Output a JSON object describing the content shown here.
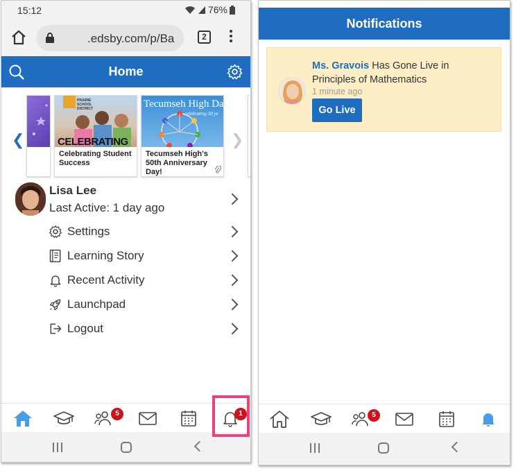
{
  "left": {
    "status": {
      "time": "15:12",
      "battery": "76%"
    },
    "browser": {
      "url": ".edsby.com/p/Ba",
      "tab_count": "2"
    },
    "header": {
      "title": "Home"
    },
    "carousel": {
      "cards": [
        {
          "caption": ""
        },
        {
          "caption": "Celebrating Student Success",
          "image_text": "CELEBRATING",
          "district": "PRAIRIE SCHOOL DISTRICT"
        },
        {
          "caption": "Tecumseh High's 50th Anniversary Day!",
          "image_text": "Tecumseh High Da",
          "image_subtext": "celebrating 50 ye"
        }
      ]
    },
    "profile": {
      "name": "Lisa Lee",
      "last_active": "Last Active: 1 day ago"
    },
    "menu": [
      {
        "label": "Settings",
        "icon": "gear-icon"
      },
      {
        "label": "Learning Story",
        "icon": "book-icon"
      },
      {
        "label": "Recent Activity",
        "icon": "bell-icon"
      },
      {
        "label": "Launchpad",
        "icon": "rocket-icon"
      },
      {
        "label": "Logout",
        "icon": "logout-icon"
      }
    ],
    "bottom_nav": {
      "groups_badge": "5",
      "notifications_badge": "1"
    }
  },
  "right": {
    "header": {
      "title": "Notifications"
    },
    "notification": {
      "sender": "Ms. Gravois",
      "message": " Has Gone Live in Principles of Mathematics",
      "time": "1 minute ago",
      "action": "Go Live"
    },
    "bottom_nav": {
      "groups_badge": "5"
    }
  },
  "colors": {
    "brand": "#1f6dc1",
    "badge": "#d0121b",
    "highlight": "#e8437e",
    "notification_bg": "#fdeec6"
  }
}
